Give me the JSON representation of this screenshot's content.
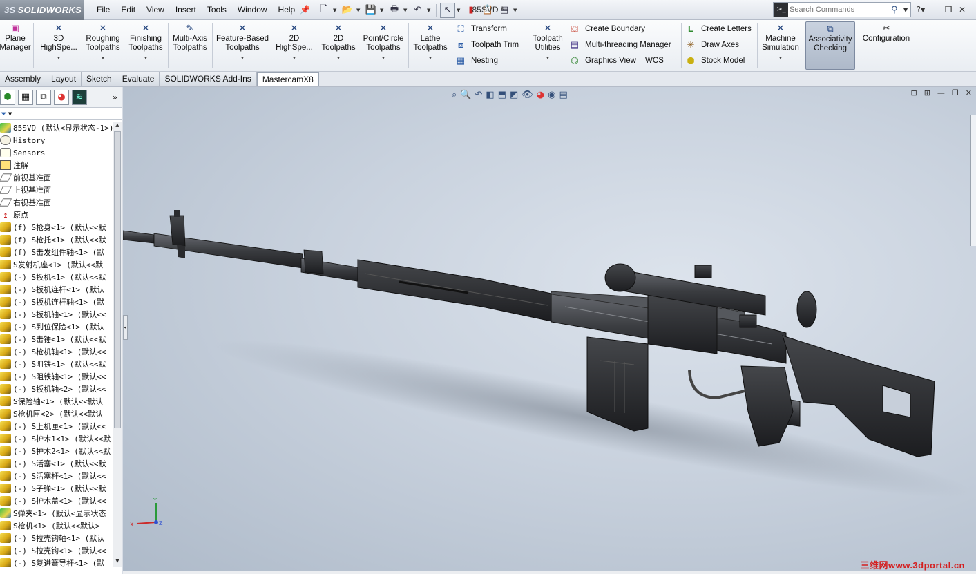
{
  "app": {
    "logo_text": "SOLIDWORKS",
    "logo_prefix": "3S",
    "document_title": "85SVD *"
  },
  "menu": [
    "File",
    "Edit",
    "View",
    "Insert",
    "Tools",
    "Window",
    "Help"
  ],
  "search": {
    "placeholder": "Search Commands"
  },
  "ribbon": {
    "plane_manager": "Plane Manager",
    "hs3d": "3D HighSpe...",
    "roughing": "Roughing Toolpaths",
    "finishing": "Finishing Toolpaths",
    "multiaxis": "Multi-Axis Toolpaths",
    "featurebased": "Feature-Based Toolpaths",
    "hs2d": "2D HighSpe...",
    "tp2d": "2D Toolpaths",
    "pointcircle": "Point/Circle Toolpaths",
    "lathe": "Lathe Toolpaths",
    "transform": "Transform",
    "toolpath_trim": "Toolpath Trim",
    "nesting": "Nesting",
    "toolpath_utilities": "Toolpath Utilities",
    "create_boundary": "Create Boundary",
    "multithreading": "Multi-threading Manager",
    "graphics_view": "Graphics View = WCS",
    "create_letters": "Create Letters",
    "draw_axes": "Draw Axes",
    "stock_model": "Stock Model",
    "machine_sim": "Machine Simulation",
    "assoc_check": "Associativity Checking",
    "configuration": "Configuration"
  },
  "tabs": [
    "Assembly",
    "Layout",
    "Sketch",
    "Evaluate",
    "SOLIDWORKS Add-Ins",
    "MastercamX8"
  ],
  "active_tab": "MastercamX8",
  "tree": [
    {
      "icon": "assembly",
      "label": "85SVD  (默认<显示状态-1>)"
    },
    {
      "icon": "history",
      "label": "History"
    },
    {
      "icon": "sensors",
      "label": "Sensors"
    },
    {
      "icon": "annotation",
      "label": "注解"
    },
    {
      "icon": "plane",
      "label": "前视基准面"
    },
    {
      "icon": "plane",
      "label": "上视基准面"
    },
    {
      "icon": "plane",
      "label": "右视基准面"
    },
    {
      "icon": "origin",
      "label": "原点"
    },
    {
      "icon": "part",
      "label": "(f) S枪身<1> (默认<<默"
    },
    {
      "icon": "part",
      "label": "(f) S枪托<1> (默认<<默"
    },
    {
      "icon": "part",
      "label": "(f) S击发组件轴<1> (默"
    },
    {
      "icon": "part",
      "label": "S发射机座<1> (默认<<默"
    },
    {
      "icon": "part",
      "label": "(-) S扳机<1> (默认<<默"
    },
    {
      "icon": "part",
      "label": "(-) S扳机连杆<1> (默认"
    },
    {
      "icon": "part",
      "label": "(-) S扳机连杆轴<1> (默"
    },
    {
      "icon": "part",
      "label": "(-) S扳机轴<1> (默认<<"
    },
    {
      "icon": "part",
      "label": "(-) S到位保险<1> (默认"
    },
    {
      "icon": "part",
      "label": "(-) S击锤<1> (默认<<默"
    },
    {
      "icon": "part",
      "label": "(-) S枪机轴<1> (默认<<"
    },
    {
      "icon": "part",
      "label": "(-) S阻铁<1> (默认<<默"
    },
    {
      "icon": "part",
      "label": "(-) S阻铁轴<1> (默认<<"
    },
    {
      "icon": "part",
      "label": "(-) S扳机轴<2> (默认<<"
    },
    {
      "icon": "part",
      "label": "S保险轴<1> (默认<<默认"
    },
    {
      "icon": "part",
      "label": "S枪机匣<2> (默认<<默认"
    },
    {
      "icon": "part",
      "label": "(-) S上机匣<1> (默认<<"
    },
    {
      "icon": "part",
      "label": "(-) S护木1<1> (默认<<默"
    },
    {
      "icon": "part",
      "label": "(-) S护木2<1> (默认<<默"
    },
    {
      "icon": "part",
      "label": "(-) S活塞<1> (默认<<默"
    },
    {
      "icon": "part",
      "label": "(-) S活塞杆<1> (默认<<"
    },
    {
      "icon": "part",
      "label": "(-) S子弹<1> (默认<<默"
    },
    {
      "icon": "part",
      "label": "(-) S护木盖<1> (默认<<"
    },
    {
      "icon": "assembly",
      "label": "S弹夹<1> (默认<显示状态"
    },
    {
      "icon": "part",
      "label": "S枪机<1> (默认<<默认>_"
    },
    {
      "icon": "part",
      "label": "(-) S拉壳钩轴<1> (默认"
    },
    {
      "icon": "part",
      "label": "(-) S拉壳钩<1> (默认<<"
    },
    {
      "icon": "part",
      "label": "(-) S复进簧导杆<1> (默"
    }
  ],
  "viewport": {
    "watermark": "三维网www.3dportal.cn",
    "triad_labels": {
      "x": "X",
      "y": "Y",
      "z": "Z"
    }
  },
  "colors": {
    "viewport_bg": "#c9d2de",
    "model_dark": "#2b2c2e",
    "watermark": "#d42020",
    "accent_active": "#aeb9c9"
  }
}
